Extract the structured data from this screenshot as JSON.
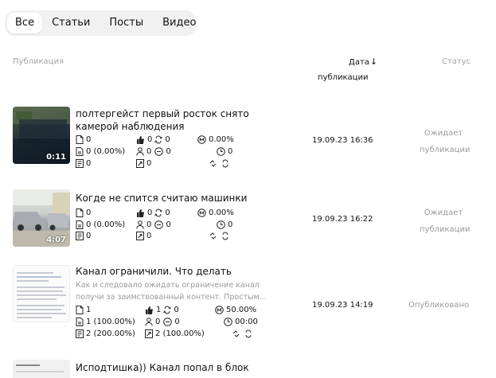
{
  "tabs": [
    {
      "label": "Все",
      "active": true
    },
    {
      "label": "Статьи",
      "active": false
    },
    {
      "label": "Посты",
      "active": false
    },
    {
      "label": "Видео",
      "active": false
    }
  ],
  "header": {
    "publication": "Публикация",
    "date_line1": "Дата",
    "date_line2": "публикации",
    "status": "Статус"
  },
  "rows": [
    {
      "title": "полтергейст первый росток снято камерой наблюдения",
      "description": "",
      "duration": "0:11",
      "stats": {
        "views": "0",
        "likes": "0",
        "reposts": "0",
        "ctr": "0.00%",
        "reads": "0 (0.00%)",
        "subscribers": "0",
        "comments": "0",
        "time": "0",
        "saves": "0",
        "shares": "0"
      },
      "date": "19.09.23 16:36",
      "status": [
        "Ожидает",
        "публикации"
      ]
    },
    {
      "title": "Когде не спится считаю машинки",
      "description": "",
      "duration": "4:07",
      "stats": {
        "views": "0",
        "likes": "0",
        "reposts": "0",
        "ctr": "0.00%",
        "reads": "0 (0.00%)",
        "subscribers": "0",
        "comments": "0",
        "time": "0",
        "saves": "0",
        "shares": "0"
      },
      "date": "19.09.23 16:22",
      "status": [
        "Ожидает",
        "публикации"
      ]
    },
    {
      "title": "Канал ограничили. Что делать",
      "description": "Как и следовало ожидать ограничение канал получи за заимствованный контент. Простым...",
      "duration": "",
      "stats": {
        "views": "1",
        "likes": "1",
        "reposts": "0",
        "ctr": "50.00%",
        "reads": "1 (100.00%)",
        "subscribers": "0",
        "comments": "0",
        "time": "00:00",
        "saves": "2 (200.00%)",
        "shares": "2 (100.00%)"
      },
      "date": "19.09.23 14:19",
      "status": [
        "Опубликовано"
      ]
    },
    {
      "title": "Исподтишка)) Канал попал в блок",
      "description": "",
      "duration": "",
      "stats": {},
      "date": "",
      "status": []
    }
  ],
  "icons": {
    "views": "document-icon",
    "likes": "thumbs-up-icon",
    "reposts": "repost-icon",
    "ctr": "ctr-icon",
    "reads": "read-icon",
    "subscribers": "user-icon",
    "comments": "comment-icon",
    "time": "clock-icon",
    "saves": "saved-icon",
    "shares": "share-icon",
    "links": "link-icon",
    "sort": "arrow-down-icon"
  }
}
